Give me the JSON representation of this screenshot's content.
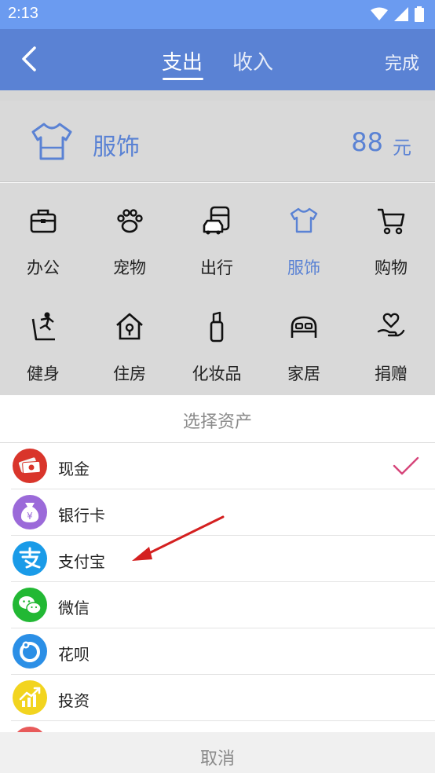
{
  "status_bar": {
    "time": "2:13"
  },
  "header": {
    "tabs": [
      {
        "label": "支出",
        "active": true
      },
      {
        "label": "收入",
        "active": false
      }
    ],
    "done_label": "完成"
  },
  "selected": {
    "category": "服饰",
    "amount": "88",
    "unit": "元"
  },
  "categories": [
    {
      "label": "办公",
      "icon": "briefcase-icon"
    },
    {
      "label": "宠物",
      "icon": "paw-icon"
    },
    {
      "label": "出行",
      "icon": "bus-car-icon"
    },
    {
      "label": "服饰",
      "icon": "tshirt-icon",
      "active": true
    },
    {
      "label": "购物",
      "icon": "cart-icon"
    },
    {
      "label": "健身",
      "icon": "treadmill-icon"
    },
    {
      "label": "住房",
      "icon": "house-icon"
    },
    {
      "label": "化妆品",
      "icon": "lipstick-icon"
    },
    {
      "label": "家居",
      "icon": "bed-icon"
    },
    {
      "label": "捐赠",
      "icon": "heart-hand-icon"
    }
  ],
  "asset_sheet": {
    "title": "选择资产",
    "items": [
      {
        "name": "现金",
        "icon": "cash-icon",
        "color": "#d9352b",
        "selected": true
      },
      {
        "name": "银行卡",
        "icon": "money-bag-icon",
        "color": "#9b6ad9"
      },
      {
        "name": "支付宝",
        "icon": "alipay-icon",
        "color": "#1a9be8"
      },
      {
        "name": "微信",
        "icon": "wechat-icon",
        "color": "#22b834"
      },
      {
        "name": "花呗",
        "icon": "huabei-icon",
        "color": "#2b8fe6"
      },
      {
        "name": "投资",
        "icon": "investment-chart-icon",
        "color": "#f2d41f"
      }
    ],
    "cancel_label": "取消"
  },
  "colors": {
    "accent": "#5a82d4",
    "status_bar": "#6b9bf0",
    "check": "#d6457a",
    "annotation_arrow": "#d42020"
  }
}
